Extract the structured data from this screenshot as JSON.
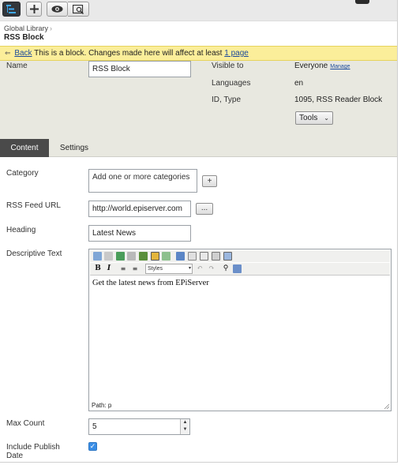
{
  "toolbar": {
    "buttons": [
      {
        "icon": "structure-icon",
        "active": true
      },
      {
        "icon": "plus-icon"
      },
      {
        "icon": "eye-icon"
      },
      {
        "icon": "preview-search-icon"
      }
    ]
  },
  "breadcrumb": {
    "parent": "Global Library",
    "sep": "›"
  },
  "block_title": "RSS Block",
  "notice": {
    "back_arrow": "⇐",
    "back_label": "Back",
    "message": "This is a block. Changes made here will affect at least",
    "link_text": "1 page"
  },
  "properties": {
    "name_label": "Name",
    "name_value": "RSS Block",
    "visible_label": "Visible to",
    "visible_value": "Everyone",
    "manage_link": "Manage",
    "languages_label": "Languages",
    "languages_value": "en",
    "id_type_label": "ID, Type",
    "id_type_value": "1095, RSS Reader Block",
    "tools_label": "Tools"
  },
  "tabs": [
    {
      "label": "Content",
      "active": true
    },
    {
      "label": "Settings",
      "active": false
    }
  ],
  "form": {
    "category_label": "Category",
    "category_placeholder": "Add one or more categories",
    "category_add": "+",
    "rss_label": "RSS Feed URL",
    "rss_value": "http://world.episerver.com",
    "rss_browse": "...",
    "heading_label": "Heading",
    "heading_value": "Latest News",
    "desc_label": "Descriptive Text",
    "editor_styles": "Styles",
    "editor_content": "Get the latest news from EPiServer",
    "editor_path": "Path: p",
    "max_count_label": "Max Count",
    "max_count_value": "5",
    "include_date_label": "Include Publish Date",
    "include_date_checked": true
  },
  "colors": {
    "notice_bg": "#fbee9a",
    "header_bg": "#e8e8e0",
    "active_tab": "#4a4a4a",
    "link": "#1b4a9b",
    "checkbox": "#3a8ee6"
  }
}
